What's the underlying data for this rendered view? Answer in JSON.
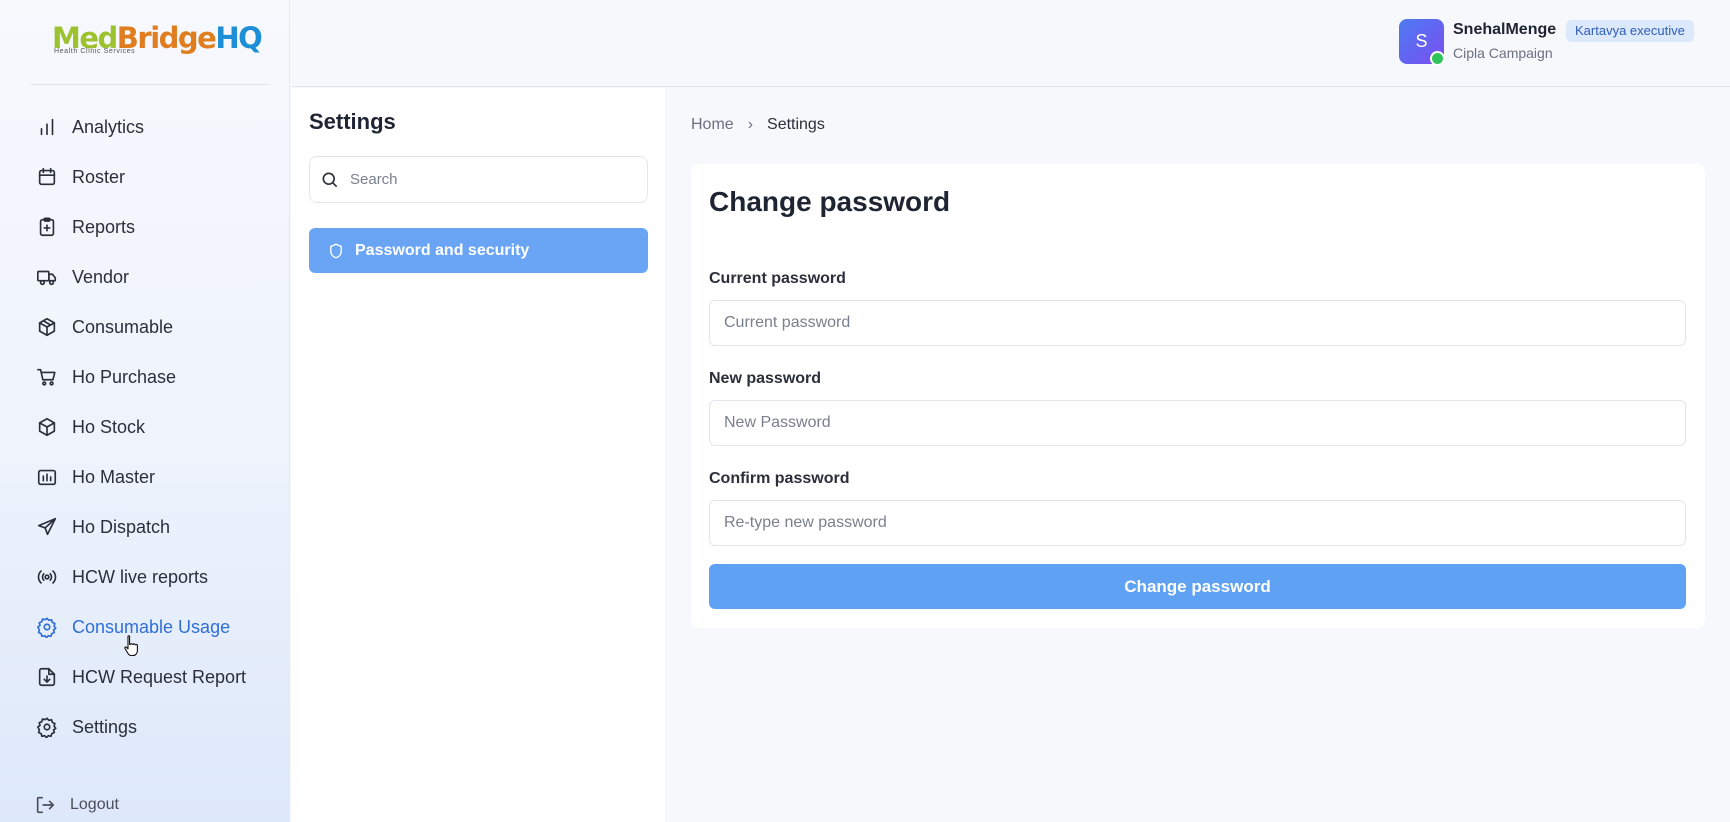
{
  "brand": {
    "logo_part1": "Med",
    "logo_part2": "Bridge",
    "logo_part3": "HQ",
    "tagline": "Health Clinic Services"
  },
  "sidebar": {
    "items": [
      {
        "label": "Analytics",
        "icon": "bar-chart-icon"
      },
      {
        "label": "Roster",
        "icon": "calendar-icon"
      },
      {
        "label": "Reports",
        "icon": "clipboard-plus-icon"
      },
      {
        "label": "Vendor",
        "icon": "truck-icon"
      },
      {
        "label": "Consumable",
        "icon": "package-icon"
      },
      {
        "label": "Ho Purchase",
        "icon": "cart-icon"
      },
      {
        "label": "Ho Stock",
        "icon": "box-icon"
      },
      {
        "label": "Ho Master",
        "icon": "folder-chart-icon"
      },
      {
        "label": "Ho Dispatch",
        "icon": "send-icon"
      },
      {
        "label": "HCW live reports",
        "icon": "broadcast-icon"
      },
      {
        "label": "Consumable Usage",
        "icon": "gear-icon"
      },
      {
        "label": "HCW Request Report",
        "icon": "file-download-icon"
      },
      {
        "label": "Settings",
        "icon": "gear-icon"
      }
    ],
    "active_index": 10,
    "logout_label": "Logout"
  },
  "header": {
    "avatar_initial": "S",
    "user_name": "SnehalMenge",
    "user_subtitle": "Cipla Campaign",
    "role_badge": "Kartavya executive",
    "online_status_color": "#2fc45a"
  },
  "settings_panel": {
    "title": "Settings",
    "search_placeholder": "Search",
    "menu_item_label": "Password and security"
  },
  "breadcrumb": {
    "home": "Home",
    "separator": "›",
    "current": "Settings"
  },
  "form": {
    "title": "Change password",
    "current_label": "Current password",
    "current_placeholder": "Current password",
    "new_label": "New password",
    "new_placeholder": "New Password",
    "confirm_label": "Confirm password",
    "confirm_placeholder": "Re-type new password",
    "submit_label": "Change password"
  },
  "colors": {
    "accent": "#5fa1f2",
    "active_nav": "#2f6fd6",
    "badge_bg": "#dce8fb"
  }
}
